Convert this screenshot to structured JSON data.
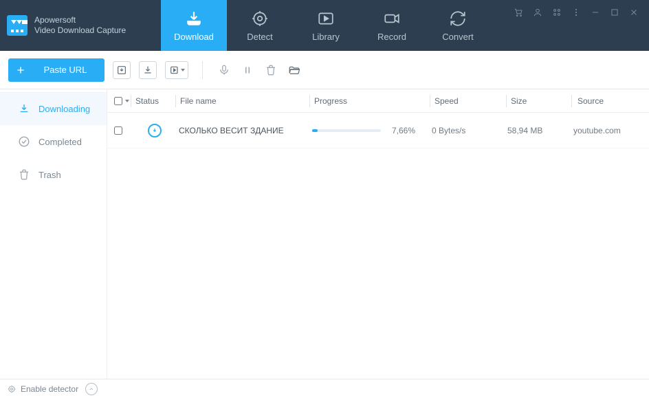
{
  "brand": {
    "line1": "Apowersoft",
    "line2": "Video Download Capture"
  },
  "nav": {
    "download": "Download",
    "detect": "Detect",
    "library": "Library",
    "record": "Record",
    "convert": "Convert"
  },
  "toolbar": {
    "paste_url_label": "Paste URL"
  },
  "sidebar": {
    "downloading": "Downloading",
    "completed": "Completed",
    "trash": "Trash"
  },
  "columns": {
    "status": "Status",
    "filename": "File name",
    "progress": "Progress",
    "speed": "Speed",
    "size": "Size",
    "source": "Source"
  },
  "rows": [
    {
      "status": "downloading",
      "filename": "СКОЛЬКО ВЕСИТ ЗДАНИЕ",
      "progress_pct": 7.66,
      "progress_label": "7,66%",
      "speed": "0 Bytes/s",
      "size": "58,94 MB",
      "source": "youtube.com"
    }
  ],
  "statusbar": {
    "enable_detector": "Enable detector"
  },
  "colors": {
    "accent": "#29aef5",
    "header": "#2c3e50"
  }
}
